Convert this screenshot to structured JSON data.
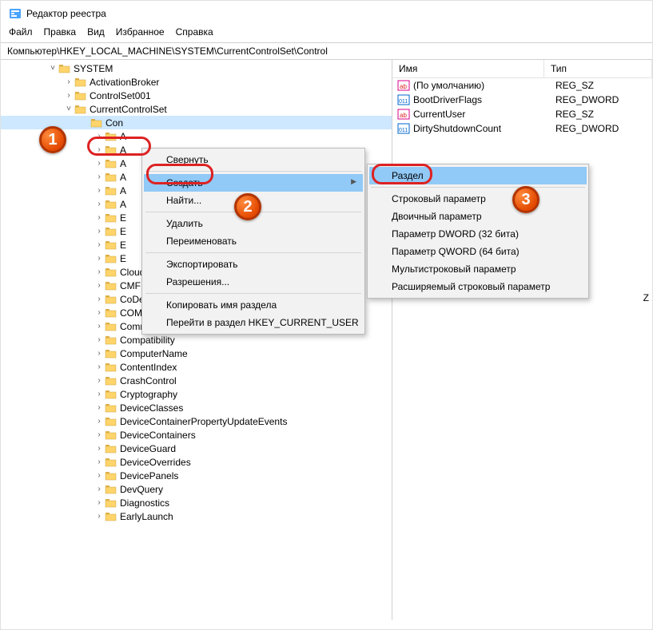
{
  "title": "Редактор реестра",
  "menu": {
    "file": "Файл",
    "edit": "Правка",
    "view": "Вид",
    "favorites": "Избранное",
    "help": "Справка"
  },
  "address": "Компьютер\\HKEY_LOCAL_MACHINE\\SYSTEM\\CurrentControlSet\\Control",
  "tree": {
    "root": "SYSTEM",
    "children": [
      "ActivationBroker",
      "ControlSet001",
      "CurrentControlSet"
    ],
    "selected": "Con",
    "sub_obscured": [
      "A",
      "A",
      "A",
      "A",
      "A",
      "A",
      "E",
      "E",
      "E",
      "E"
    ],
    "sub_visible": [
      "CloudDomainJoin",
      "CMF",
      "CoDeviceInstallers",
      "COM Name Arbiter",
      "CommonGlobUserSettings",
      "Compatibility",
      "ComputerName",
      "ContentIndex",
      "CrashControl",
      "Cryptography",
      "DeviceClasses",
      "DeviceContainerPropertyUpdateEvents",
      "DeviceContainers",
      "DeviceGuard",
      "DeviceOverrides",
      "DevicePanels",
      "DevQuery",
      "Diagnostics",
      "EarlyLaunch"
    ]
  },
  "list": {
    "header_name": "Имя",
    "header_type": "Тип",
    "rows": [
      {
        "icon": "sz",
        "name": "(По умолчанию)",
        "type": "REG_SZ"
      },
      {
        "icon": "dword",
        "name": "BootDriverFlags",
        "type": "REG_DWORD"
      },
      {
        "icon": "sz",
        "name": "CurrentUser",
        "type": "REG_SZ"
      },
      {
        "icon": "dword",
        "name": "DirtyShutdownCount",
        "type": "REG_DWORD"
      }
    ],
    "extra_type_peek": "Z"
  },
  "ctx1": {
    "collapse": "Свернуть",
    "create": "Создать",
    "find": "Найти...",
    "delete": "Удалить",
    "rename": "Переименовать",
    "export": "Экспортировать",
    "permissions": "Разрешения...",
    "copy_key_name": "Копировать имя раздела",
    "goto_hkcu": "Перейти в раздел HKEY_CURRENT_USER"
  },
  "ctx2": {
    "key": "Раздел",
    "string": "Строковый параметр",
    "binary": "Двоичный параметр",
    "dword": "Параметр DWORD (32 бита)",
    "qword": "Параметр QWORD (64 бита)",
    "multi": "Мультистроковый параметр",
    "expand": "Расширяемый строковый параметр"
  }
}
